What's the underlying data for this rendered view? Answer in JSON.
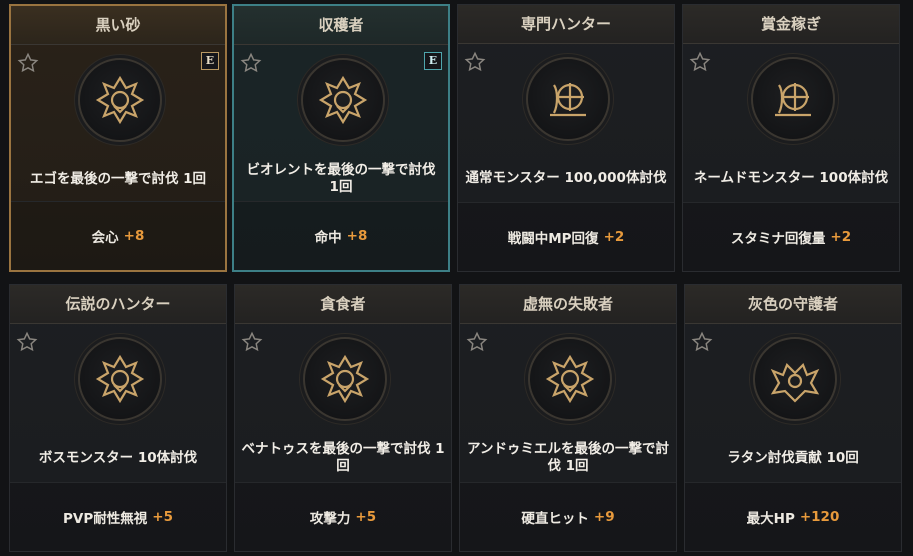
{
  "cards": [
    {
      "title": "黒い砂",
      "condition": "エゴを最後の一撃で討伐 1回",
      "stat": "会心",
      "value": "+8",
      "badge": "E",
      "emblem": "spiked-mask",
      "state": "selected-gold"
    },
    {
      "title": "収穫者",
      "condition": "ビオレントを最後の一撃で討伐 1回",
      "stat": "命中",
      "value": "+8",
      "badge": "E",
      "emblem": "spiked-mask",
      "state": "selected-teal"
    },
    {
      "title": "専門ハンター",
      "condition": "通常モンスター 100,000体討伐",
      "stat": "戦闘中MP回復",
      "value": "+2",
      "badge": "",
      "emblem": "crosshair-orb",
      "state": "normal"
    },
    {
      "title": "賞金稼ぎ",
      "condition": "ネームドモンスター 100体討伐",
      "stat": "スタミナ回復量",
      "value": "+2",
      "badge": "",
      "emblem": "crosshair-orb",
      "state": "normal"
    },
    {
      "title": "伝説のハンター",
      "condition": "ボスモンスター 10体討伐",
      "stat": "PVP耐性無視",
      "value": "+5",
      "badge": "",
      "emblem": "spiked-mask",
      "state": "normal"
    },
    {
      "title": "貪食者",
      "condition": "ベナトゥスを最後の一撃で討伐 1回",
      "stat": "攻撃力",
      "value": "+5",
      "badge": "",
      "emblem": "spiked-mask",
      "state": "normal"
    },
    {
      "title": "虚無の失敗者",
      "condition": "アンドゥミエルを最後の一撃で討伐 1回",
      "stat": "硬直ヒット",
      "value": "+9",
      "badge": "",
      "emblem": "spiked-mask",
      "state": "normal"
    },
    {
      "title": "灰色の守護者",
      "condition": "ラタン討伐貢献 10回",
      "stat": "最大HP",
      "value": "+120",
      "badge": "",
      "emblem": "winged-skull",
      "state": "normal"
    }
  ],
  "colors": {
    "accent": "#e89a3c",
    "gold_border": "#9a7440",
    "teal_border": "#3d7f86",
    "emblem_gold": "#c9a46a"
  },
  "icons": {
    "favorite": "star-outline-icon"
  }
}
